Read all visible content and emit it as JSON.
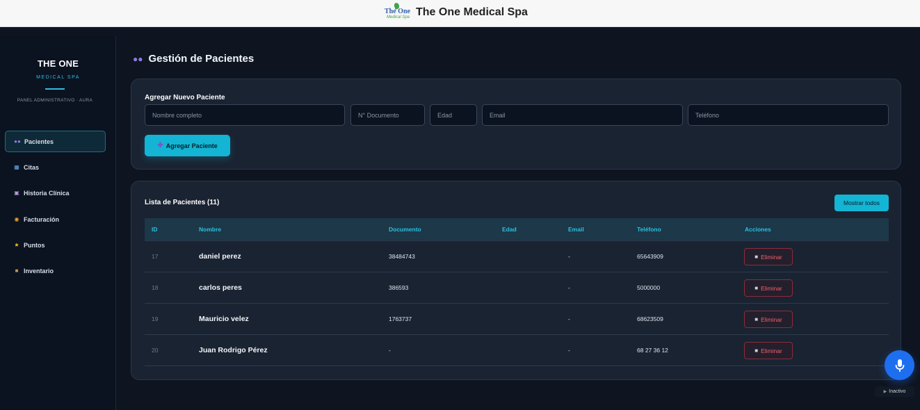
{
  "header": {
    "logo_text": "The One",
    "logo_subtext": "Medical Spa",
    "title": "The One Medical Spa"
  },
  "sidebar": {
    "brand_title": "THE ONE",
    "brand_subtitle": "MEDICAL SPA",
    "panel_label": "PANEL ADMINISTRATIVO · AURA",
    "items": [
      {
        "label": "Pacientes",
        "icon": "users-icon",
        "active": true
      },
      {
        "label": "Citas",
        "icon": "calendar-icon",
        "active": false
      },
      {
        "label": "Historia Clínica",
        "icon": "clipboard-icon",
        "active": false
      },
      {
        "label": "Facturación",
        "icon": "money-bag-icon",
        "active": false
      },
      {
        "label": "Puntos",
        "icon": "star-icon",
        "active": false
      },
      {
        "label": "Inventario",
        "icon": "package-icon",
        "active": false
      }
    ]
  },
  "main": {
    "title": "Gestión de Pacientes",
    "add_form": {
      "title": "Agregar Nuevo Paciente",
      "fields": {
        "name_placeholder": "Nombre completo",
        "document_placeholder": "N° Documento",
        "age_placeholder": "Edad",
        "email_placeholder": "Email",
        "phone_placeholder": "Teléfono"
      },
      "submit_label": "Agregar Paciente"
    },
    "patient_list": {
      "title": "Lista de Pacientes (11)",
      "show_all_label": "Mostrar todos",
      "columns": [
        "ID",
        "Nombre",
        "Documento",
        "Edad",
        "Email",
        "Teléfono",
        "Acciones"
      ],
      "delete_label": "Eliminar",
      "rows": [
        {
          "id": "17",
          "name": "daniel perez",
          "document": "38484743",
          "age": "",
          "email": "-",
          "phone": "65643909"
        },
        {
          "id": "18",
          "name": "carlos peres",
          "document": "386593",
          "age": "",
          "email": "-",
          "phone": "5000000"
        },
        {
          "id": "19",
          "name": "Mauricio velez",
          "document": "1763737",
          "age": "",
          "email": "-",
          "phone": "68623509"
        },
        {
          "id": "20",
          "name": "Juan Rodrigo Pérez",
          "document": "-",
          "age": "",
          "email": "-",
          "phone": "68 27 36 12"
        }
      ]
    }
  },
  "voice": {
    "status": "Inactivo"
  },
  "colors": {
    "accent": "#14b4d4",
    "background": "#0e1420",
    "card": "#1a2332",
    "danger": "#f0606c",
    "mic": "#1e6ff0"
  }
}
